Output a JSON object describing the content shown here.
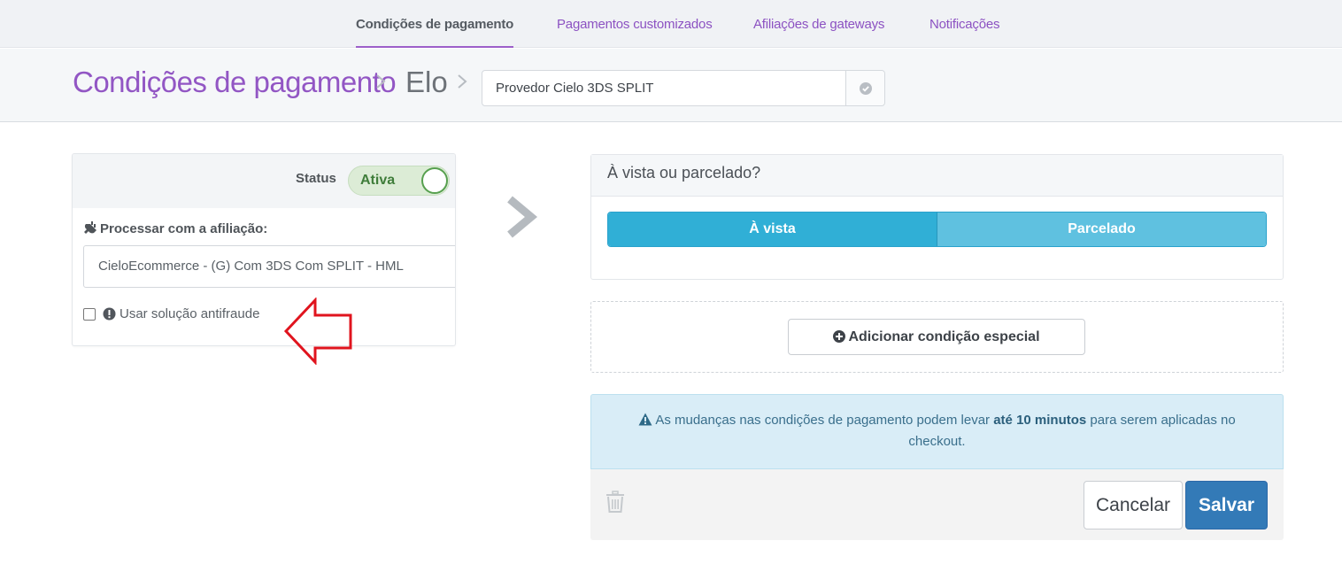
{
  "topnav": {
    "tabs": [
      {
        "label": "Condições de pagamento",
        "active": true
      },
      {
        "label": "Pagamentos customizados",
        "active": false
      },
      {
        "label": "Afiliações de gateways",
        "active": false
      },
      {
        "label": "Notificações",
        "active": false
      }
    ]
  },
  "breadcrumb": {
    "title": "Condições de pagamento",
    "item": "Elo",
    "provider_value": "Provedor Cielo 3DS SPLIT"
  },
  "left_card": {
    "status_label": "Status",
    "status_value": "Ativa",
    "processor_label": "Processar com a afiliação:",
    "affiliation_value": "CieloEcommerce - (G) Com 3DS Com SPLIT - HML",
    "antifraud_label": "Usar solução antifraude",
    "antifraud_checked": false
  },
  "payment_type": {
    "question": "À vista ou parcelado?",
    "options": [
      "À vista",
      "Parcelado"
    ],
    "selected": "À vista"
  },
  "special": {
    "add_label": "Adicionar condição especial"
  },
  "info": {
    "text_before": "As mudanças nas condições de pagamento podem levar ",
    "text_bold": "até 10 minutos",
    "text_after": " para serem aplicadas no checkout."
  },
  "footer": {
    "cancel_label": "Cancelar",
    "save_label": "Salvar"
  },
  "colors": {
    "accent_purple": "#9256c4",
    "toggle_green": "#57a04f",
    "segment_blue": "#30afd6",
    "save_blue": "#337ab7",
    "annotation_red": "#e0141e"
  }
}
